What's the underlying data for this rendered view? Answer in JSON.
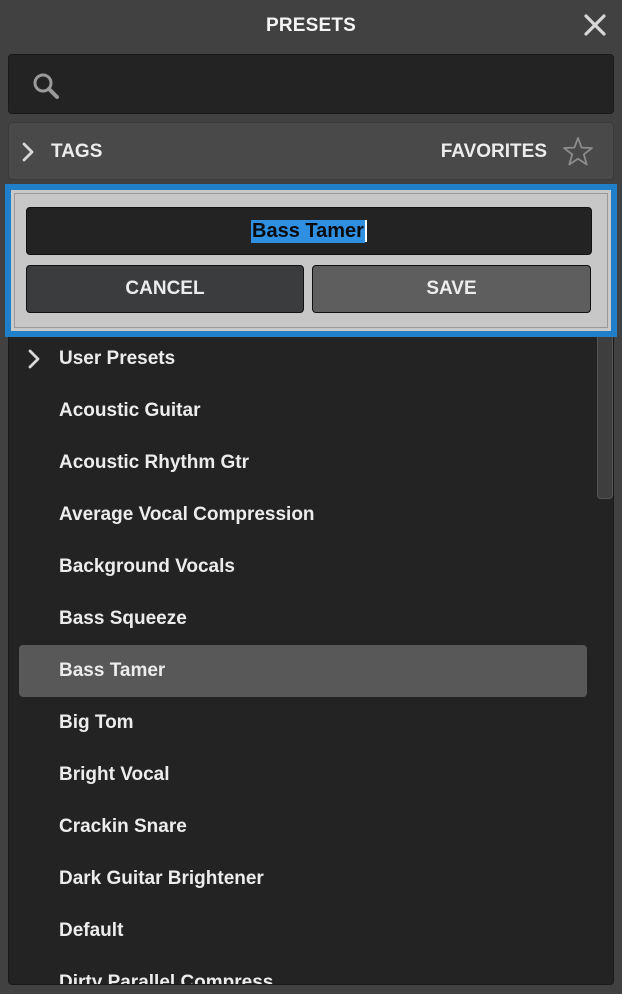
{
  "header": {
    "title": "PRESETS"
  },
  "search": {
    "value": "",
    "placeholder": ""
  },
  "filter_bar": {
    "tags_label": "TAGS",
    "favorites_label": "FAVORITES"
  },
  "save_dialog": {
    "name_value": "Bass Tamer",
    "cancel_label": "CANCEL",
    "save_label": "SAVE"
  },
  "presets": {
    "folder": "User Presets",
    "items": [
      "Acoustic Guitar",
      "Acoustic Rhythm Gtr",
      "Average Vocal Compression",
      "Background Vocals",
      "Bass Squeeze",
      "Bass Tamer",
      "Big Tom",
      "Bright Vocal",
      "Crackin Snare",
      "Dark Guitar Brightener",
      "Default",
      "Dirty Parallel Compress"
    ],
    "selected": "Bass Tamer"
  },
  "colors": {
    "focus_ring": "#1f7fc9",
    "text_selection": "#2f8fe0",
    "selected_row": "#585859"
  }
}
